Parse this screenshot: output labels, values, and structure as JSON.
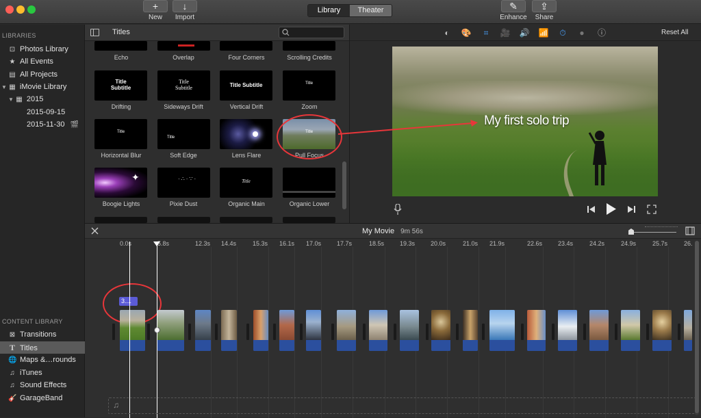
{
  "toolbar": {
    "new_label": "New",
    "import_label": "Import",
    "library_label": "Library",
    "theater_label": "Theater",
    "enhance_label": "Enhance",
    "share_label": "Share",
    "new_icon": "+",
    "import_icon": "↓",
    "enhance_icon": "✎",
    "share_icon": "⇪"
  },
  "sidebar": {
    "libraries_header": "LIBRARIES",
    "items": [
      {
        "label": "Photos Library",
        "icon": "⊡"
      },
      {
        "label": "All Events",
        "icon": "★"
      },
      {
        "label": "All Projects",
        "icon": "▤"
      },
      {
        "label": "iMovie Library",
        "icon": "▦",
        "arrow": "▼"
      },
      {
        "label": "2015",
        "icon": "▦",
        "arrow": "▼"
      },
      {
        "label": "2015-09-15"
      },
      {
        "label": "2015-11-30",
        "icon": "🎬"
      }
    ],
    "content_header": "CONTENT LIBRARY",
    "content_items": [
      {
        "label": "Transitions",
        "icon": "⊠"
      },
      {
        "label": "Titles",
        "icon": "T"
      },
      {
        "label": "Maps &…rounds",
        "icon": "🌐"
      },
      {
        "label": "iTunes",
        "icon": "♫"
      },
      {
        "label": "Sound Effects",
        "icon": "♫"
      },
      {
        "label": "GarageBand",
        "icon": "🎸"
      }
    ]
  },
  "browser": {
    "title": "Titles",
    "top_row_labels": [
      "Echo",
      "Overlap",
      "Four Corners",
      "Scrolling Credits"
    ],
    "rows": [
      [
        {
          "label": "Drifting",
          "thumb": "Title\nSubtitle"
        },
        {
          "label": "Sideways Drift",
          "thumb": "Title\nSubtitle"
        },
        {
          "label": "Vertical Drift",
          "thumb": "Title Subtitle"
        },
        {
          "label": "Zoom",
          "thumb": "Title"
        }
      ],
      [
        {
          "label": "Horizontal Blur",
          "thumb": "Title"
        },
        {
          "label": "Soft Edge",
          "thumb": "Title"
        },
        {
          "label": "Lens Flare",
          "thumb": ""
        },
        {
          "label": "Pull Focus",
          "thumb": "Title"
        }
      ],
      [
        {
          "label": "Boogie Lights",
          "thumb": ""
        },
        {
          "label": "Pixie Dust",
          "thumb": ""
        },
        {
          "label": "Organic Main",
          "thumb": "Title"
        },
        {
          "label": "Organic Lower",
          "thumb": ""
        }
      ]
    ]
  },
  "viewer": {
    "reset_label": "Reset All",
    "overlay_text": "My first solo trip",
    "tool_icons": [
      "◐",
      "🎨",
      "⌗",
      "🎥",
      "🔊",
      "📶",
      "⏱",
      "●",
      "ⓘ"
    ]
  },
  "timeline": {
    "title": "My Movie",
    "duration": "9m 56s",
    "title_clip_label": "3....",
    "ticks": [
      "0.0s",
      "5.8s",
      "12.3s",
      "14.4s",
      "15.3s",
      "16.1s",
      "17.0s",
      "17.7s",
      "18.5s",
      "19.3s",
      "20.0s",
      "21.0s",
      "21.9s",
      "22.6s",
      "23.4s",
      "24.2s",
      "24.9s",
      "25.7s",
      "26."
    ]
  },
  "colors": {
    "annotation": "#e8363a",
    "clip_blue": "#2b4f9e",
    "title_clip": "#5b5bd6",
    "selected": "#5a5a5a"
  }
}
